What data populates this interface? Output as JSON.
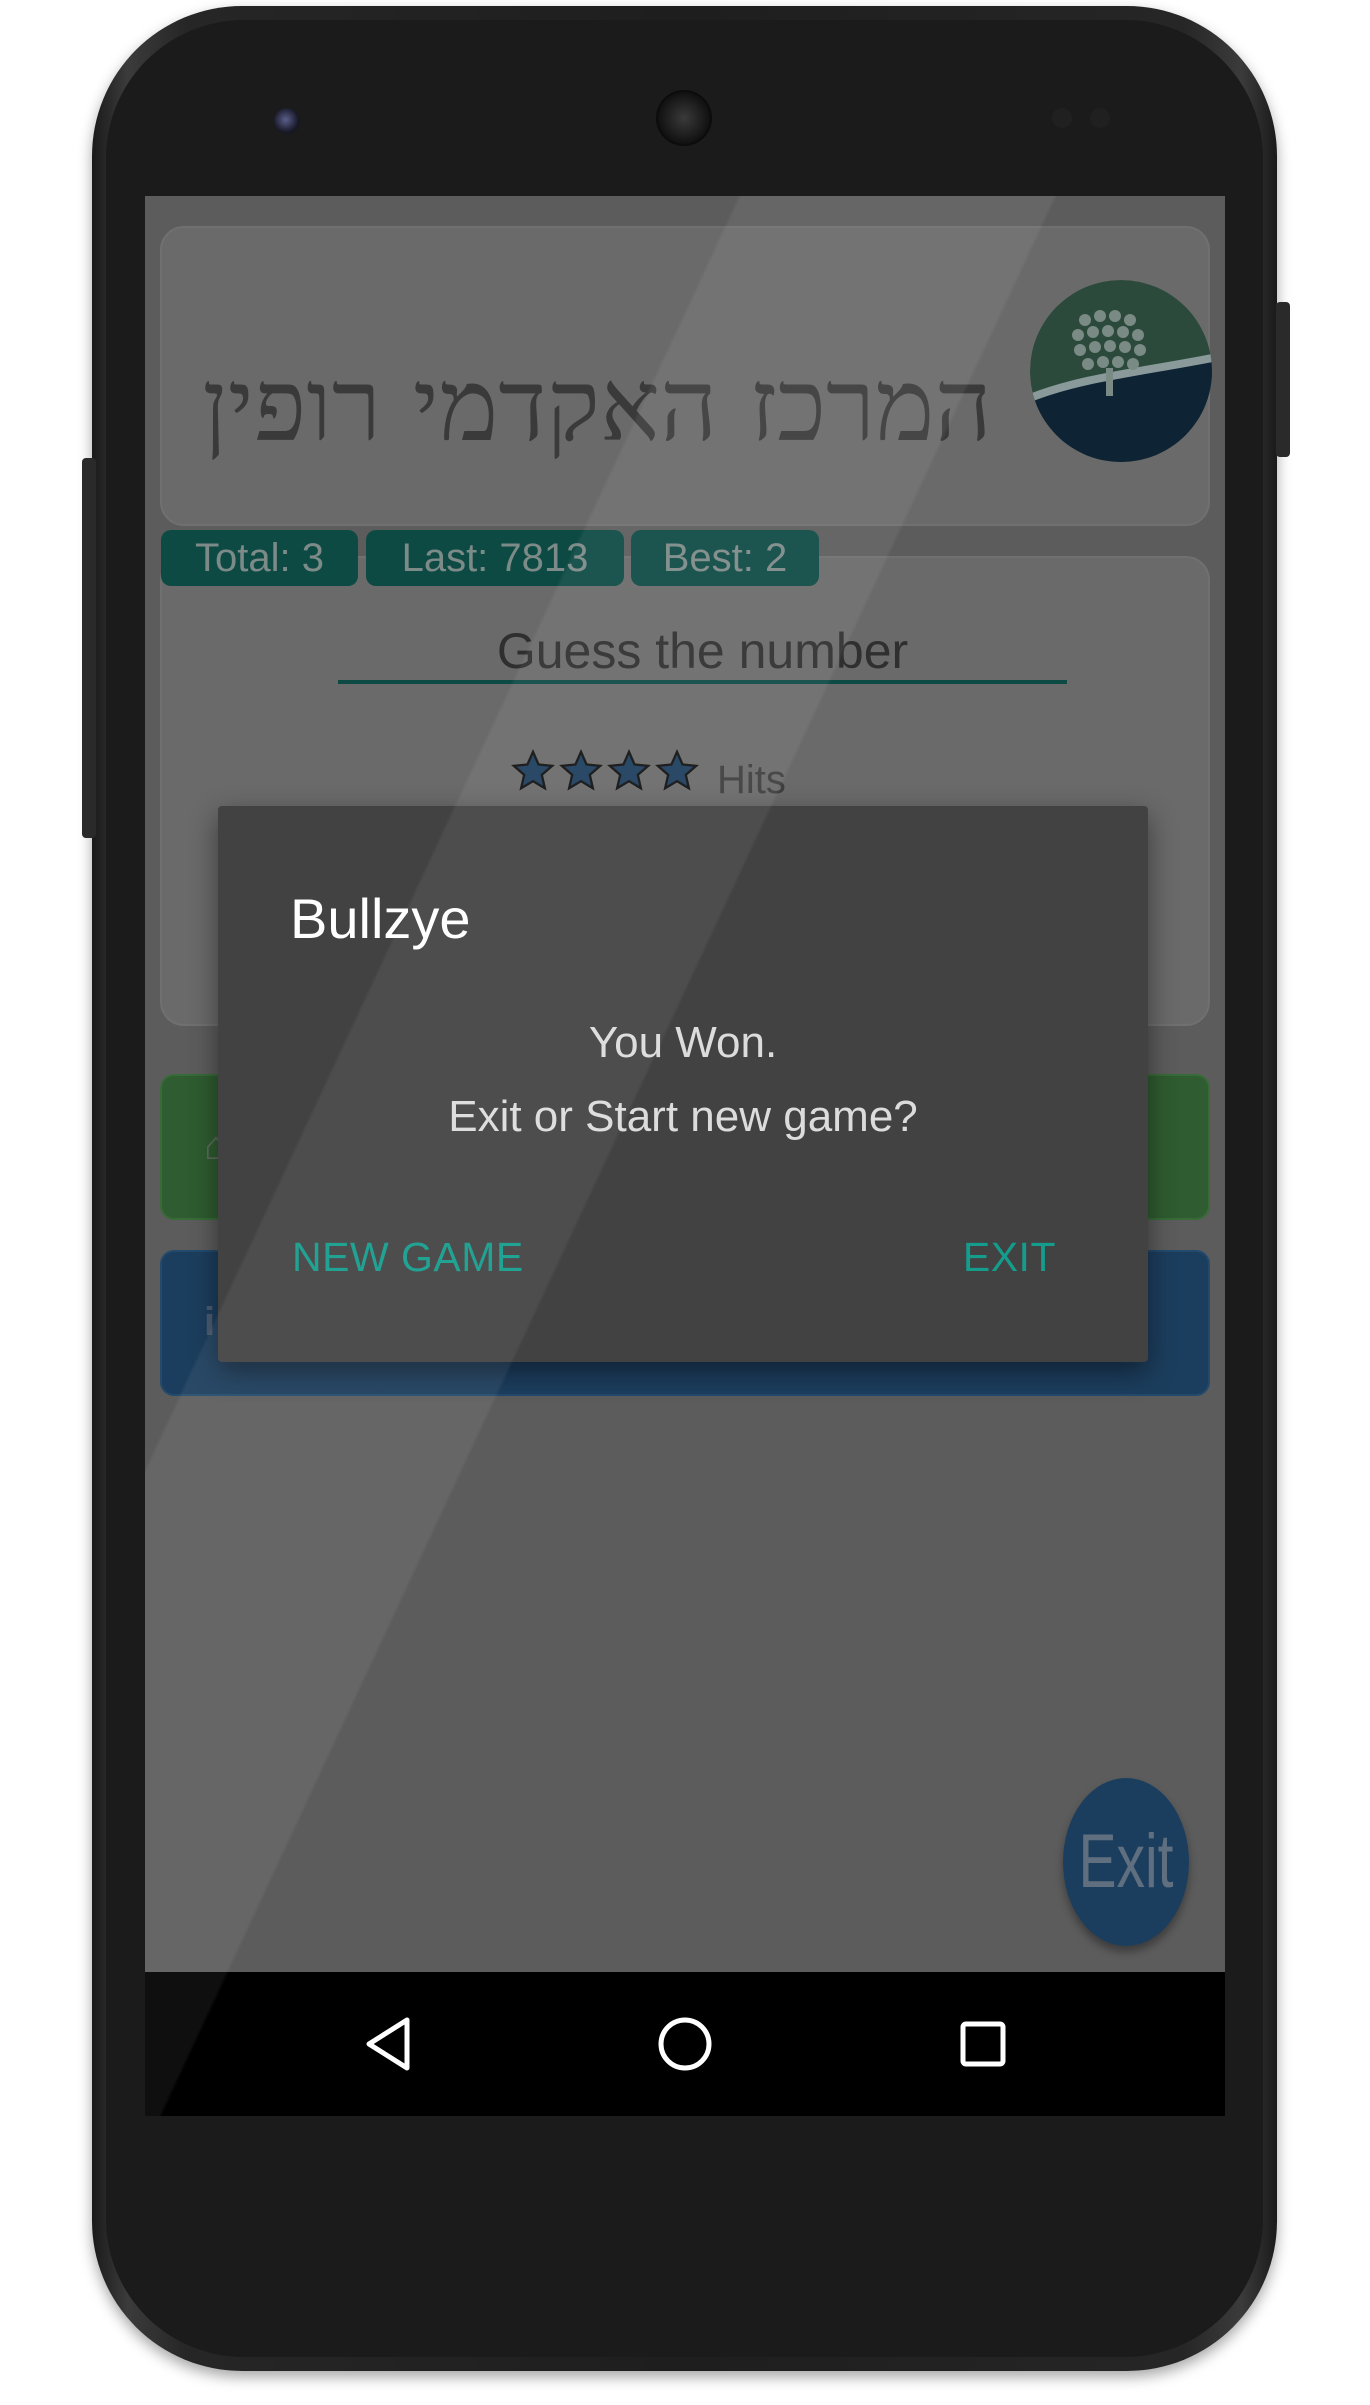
{
  "header": {
    "logo_text": "המרכז האקדמי רופין",
    "logo_icon": "tree-in-circle-icon"
  },
  "stats": {
    "total": "Total: 3",
    "last": "Last: 7813",
    "best": "Best: 2"
  },
  "game": {
    "guess_placeholder": "Guess the number",
    "rating_stars": 4,
    "hits_label": "Hits"
  },
  "dialog": {
    "title": "Bullzye",
    "message_line1": "You Won.",
    "message_line2": "Exit or Start new game?",
    "new_game_label": "NEW GAME",
    "exit_label": "EXIT"
  },
  "fab": {
    "label": "Exit"
  },
  "navbar": {
    "back_icon": "back-triangle-icon",
    "home_icon": "home-circle-icon",
    "recent_icon": "recent-apps-square-icon"
  },
  "colors": {
    "accent": "#149c8c",
    "chip_bg": "#0e4a44",
    "dialog_bg": "#424242",
    "fab_bg": "#1c3e5e",
    "green_button": "#2f5c30",
    "blue_button": "#1c3e5e"
  }
}
